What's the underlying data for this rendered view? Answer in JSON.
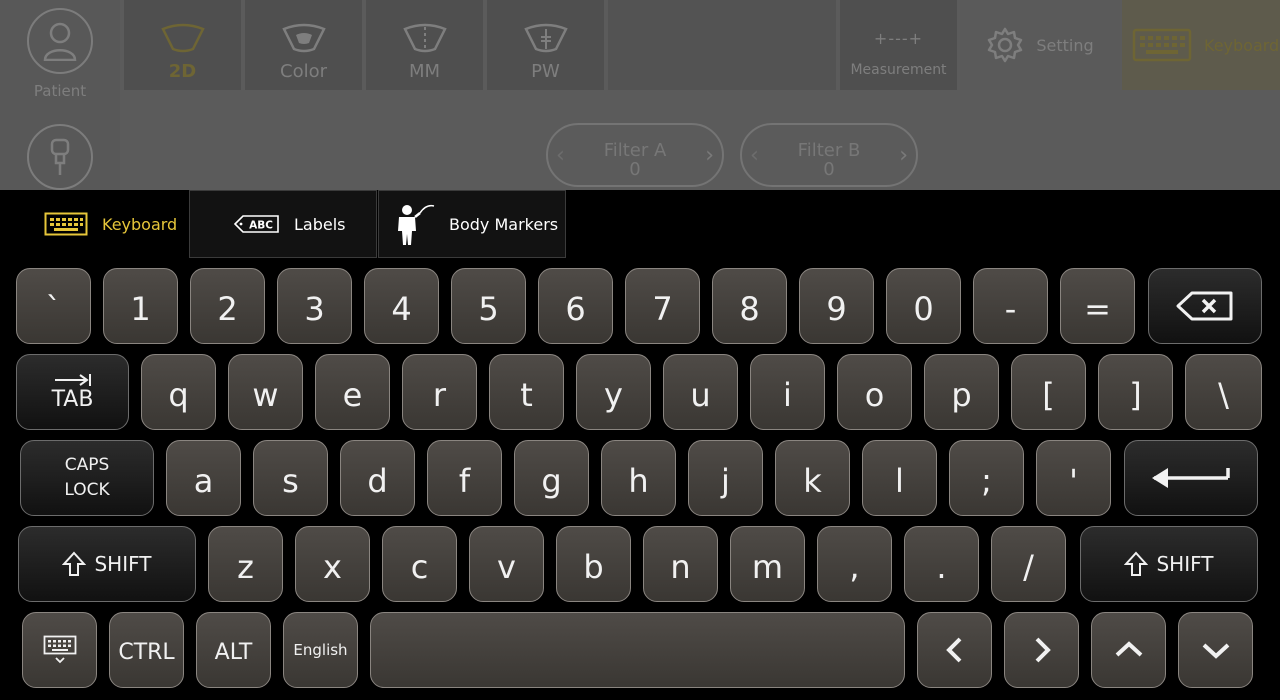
{
  "top": {
    "rail": {
      "patient": "Patient"
    },
    "modes": [
      {
        "label": "2D",
        "active": true
      },
      {
        "label": "Color",
        "active": false
      },
      {
        "label": "MM",
        "active": false
      },
      {
        "label": "PW",
        "active": false
      }
    ],
    "measurement": {
      "icon": "+---+",
      "label": "Measurement"
    },
    "setting": "Setting",
    "keyboard": "Keyboard",
    "filters": [
      {
        "label": "Filter A",
        "value": "0"
      },
      {
        "label": "Filter B",
        "value": "0"
      }
    ]
  },
  "tabs": [
    {
      "label": "Keyboard",
      "icon": "keyboard-icon",
      "active": true
    },
    {
      "label": "Labels",
      "icon": "abc-label-icon",
      "active": false
    },
    {
      "label": "Body Markers",
      "icon": "body-marker-icon",
      "active": false
    }
  ],
  "keys": {
    "row1": [
      "`",
      "1",
      "2",
      "3",
      "4",
      "5",
      "6",
      "7",
      "8",
      "9",
      "0",
      "-",
      "="
    ],
    "tab": "TAB",
    "row2": [
      "q",
      "w",
      "e",
      "r",
      "t",
      "y",
      "u",
      "i",
      "o",
      "p",
      "[",
      "]",
      "\\"
    ],
    "caps": [
      "CAPS",
      "LOCK"
    ],
    "row3": [
      "a",
      "s",
      "d",
      "f",
      "g",
      "h",
      "j",
      "k",
      "l",
      ";",
      "'"
    ],
    "shift": "SHIFT",
    "row4": [
      "z",
      "x",
      "c",
      "v",
      "b",
      "n",
      "m",
      ",",
      ".",
      "/"
    ],
    "ctrl": "CTRL",
    "alt": "ALT",
    "language": "English"
  },
  "colors": {
    "accent": "#e6c63a",
    "key_face": "#45413d",
    "key_border": "#8a8580"
  }
}
